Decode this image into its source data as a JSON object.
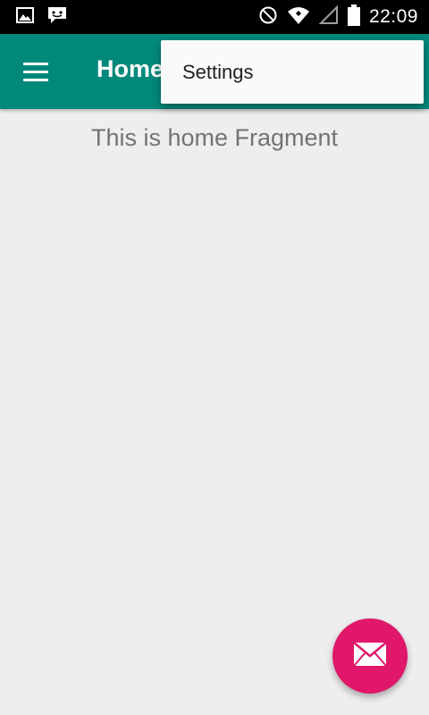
{
  "status_bar": {
    "time": "22:09",
    "icons": [
      "image-icon",
      "chat-icon",
      "do-not-disturb-icon",
      "wifi-icon",
      "signal-icon",
      "battery-icon"
    ]
  },
  "app_bar": {
    "title": "Home",
    "background_color": "#00897b",
    "menu_icon": "hamburger-menu-icon"
  },
  "overflow_menu": {
    "items": [
      {
        "label": "Settings"
      }
    ]
  },
  "content": {
    "text": "This is home Fragment"
  },
  "fab": {
    "icon": "mail-icon",
    "color": "#e0176a"
  }
}
